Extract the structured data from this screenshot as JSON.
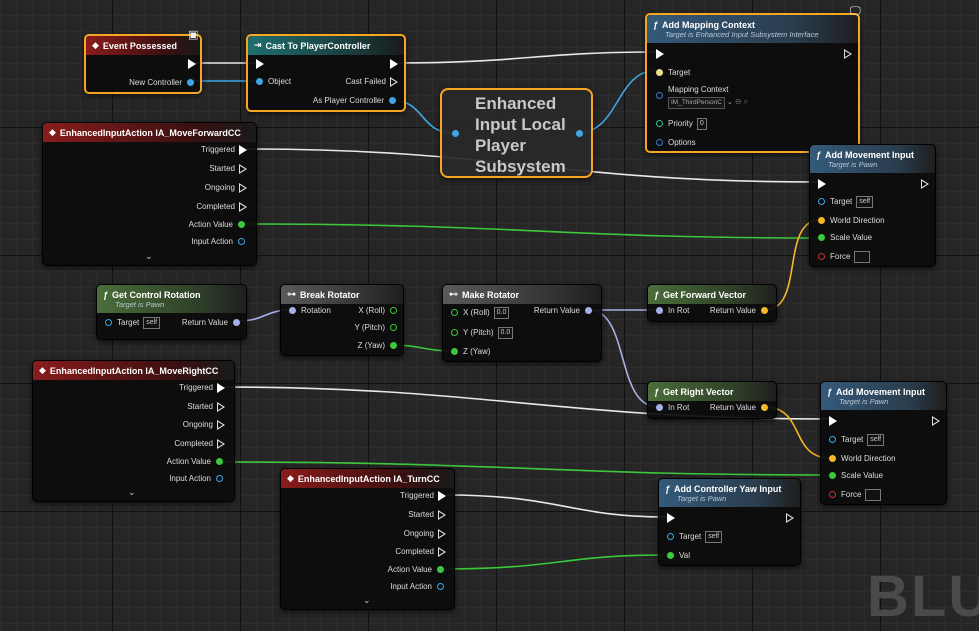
{
  "nodes": {
    "event_possessed": {
      "title": "Event Possessed",
      "pins": {
        "new_controller": "New Controller"
      }
    },
    "cast": {
      "title": "Cast To PlayerController",
      "pins": {
        "object": "Object",
        "cast_failed": "Cast Failed",
        "as_pc": "As Player Controller"
      }
    },
    "subsystem": {
      "lines": [
        "Enhanced",
        "Input Local",
        "Player",
        "Subsystem"
      ]
    },
    "add_mapping": {
      "title": "Add Mapping Context",
      "subtitle": "Target is Enhanced Input Subsystem Interface",
      "pins": {
        "target": "Target",
        "mapping": "Mapping Context",
        "mapping_value": "IM_ThirdPersonC",
        "priority": "Priority",
        "priority_value": "0",
        "options": "Options"
      }
    },
    "move_forward": {
      "title": "EnhancedInputAction IA_MoveForwardCC",
      "pins": {
        "triggered": "Triggered",
        "started": "Started",
        "ongoing": "Ongoing",
        "completed": "Completed",
        "action_value": "Action Value",
        "input_action": "Input Action"
      }
    },
    "add_move_1": {
      "title": "Add Movement Input",
      "subtitle": "Target is Pawn",
      "pins": {
        "target": "Target",
        "target_value": "self",
        "world_dir": "World Direction",
        "scale": "Scale Value",
        "force": "Force"
      }
    },
    "get_ctrl_rot": {
      "title": "Get Control Rotation",
      "subtitle": "Target is Pawn",
      "pins": {
        "target": "Target",
        "target_value": "self",
        "ret": "Return Value"
      }
    },
    "break_rot": {
      "title": "Break Rotator",
      "pins": {
        "rotation": "Rotation",
        "x": "X (Roll)",
        "y": "Y (Pitch)",
        "z": "Z (Yaw)"
      }
    },
    "make_rot": {
      "title": "Make Rotator",
      "pins": {
        "x": "X (Roll)",
        "x_value": "0.0",
        "y": "Y (Pitch)",
        "y_value": "0.0",
        "z": "Z (Yaw)",
        "ret": "Return Value"
      }
    },
    "get_fwd": {
      "title": "Get Forward Vector",
      "pins": {
        "in_rot": "In Rot",
        "ret": "Return Value"
      }
    },
    "move_right": {
      "title": "EnhancedInputAction IA_MoveRightCC",
      "pins": {
        "triggered": "Triggered",
        "started": "Started",
        "ongoing": "Ongoing",
        "completed": "Completed",
        "action_value": "Action Value",
        "input_action": "Input Action"
      }
    },
    "get_right": {
      "title": "Get Right Vector",
      "pins": {
        "in_rot": "In Rot",
        "ret": "Return Value"
      }
    },
    "add_move_2": {
      "title": "Add Movement Input",
      "subtitle": "Target is Pawn",
      "pins": {
        "target": "Target",
        "target_value": "self",
        "world_dir": "World Direction",
        "scale": "Scale Value",
        "force": "Force"
      }
    },
    "turn": {
      "title": "EnhancedInputAction IA_TurnCC",
      "pins": {
        "triggered": "Triggered",
        "started": "Started",
        "ongoing": "Ongoing",
        "completed": "Completed",
        "action_value": "Action Value",
        "input_action": "Input Action"
      }
    },
    "yaw": {
      "title": "Add Controller Yaw Input",
      "subtitle": "Target is Pawn",
      "pins": {
        "target": "Target",
        "target_value": "self",
        "val": "Val"
      }
    }
  },
  "watermark": "BLUEPRINT",
  "colors": {
    "exec": "#ffffff",
    "object": "#3fa6e6",
    "float": "#3cc83c",
    "vector": "#f5b827",
    "rotator": "#a7b0e8",
    "selection": "#f5a623"
  }
}
